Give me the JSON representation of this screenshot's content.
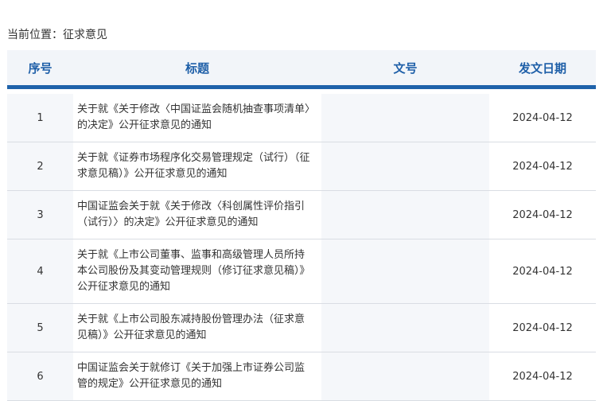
{
  "breadcrumb": {
    "label": "当前位置：",
    "current": "征求意见"
  },
  "table": {
    "headers": {
      "seq": "序号",
      "title": "标题",
      "doc": "文号",
      "date": "发文日期"
    },
    "rows": [
      {
        "seq": "1",
        "title": "关于就《关于修改〈中国证监会随机抽查事项清单〉的决定》公开征求意见的通知",
        "doc": "",
        "date": "2024-04-12"
      },
      {
        "seq": "2",
        "title": "关于就《证券市场程序化交易管理规定（试行）（征求意见稿）》公开征求意见的通知",
        "doc": "",
        "date": "2024-04-12"
      },
      {
        "seq": "3",
        "title": "中国证监会关于就《关于修改〈科创属性评价指引（试行）〉的决定》公开征求意见的通知",
        "doc": "",
        "date": "2024-04-12"
      },
      {
        "seq": "4",
        "title": "关于就《上市公司董事、监事和高级管理人员所持本公司股份及其变动管理规则（修订征求意见稿）》公开征求意见的通知",
        "doc": "",
        "date": "2024-04-12"
      },
      {
        "seq": "5",
        "title": "关于就《上市公司股东减持股份管理办法（征求意见稿）》公开征求意见的通知",
        "doc": "",
        "date": "2024-04-12"
      },
      {
        "seq": "6",
        "title": "中国证监会关于就修订《关于加强上市证券公司监管的规定》公开征求意见的通知",
        "doc": "",
        "date": "2024-04-12"
      }
    ]
  }
}
